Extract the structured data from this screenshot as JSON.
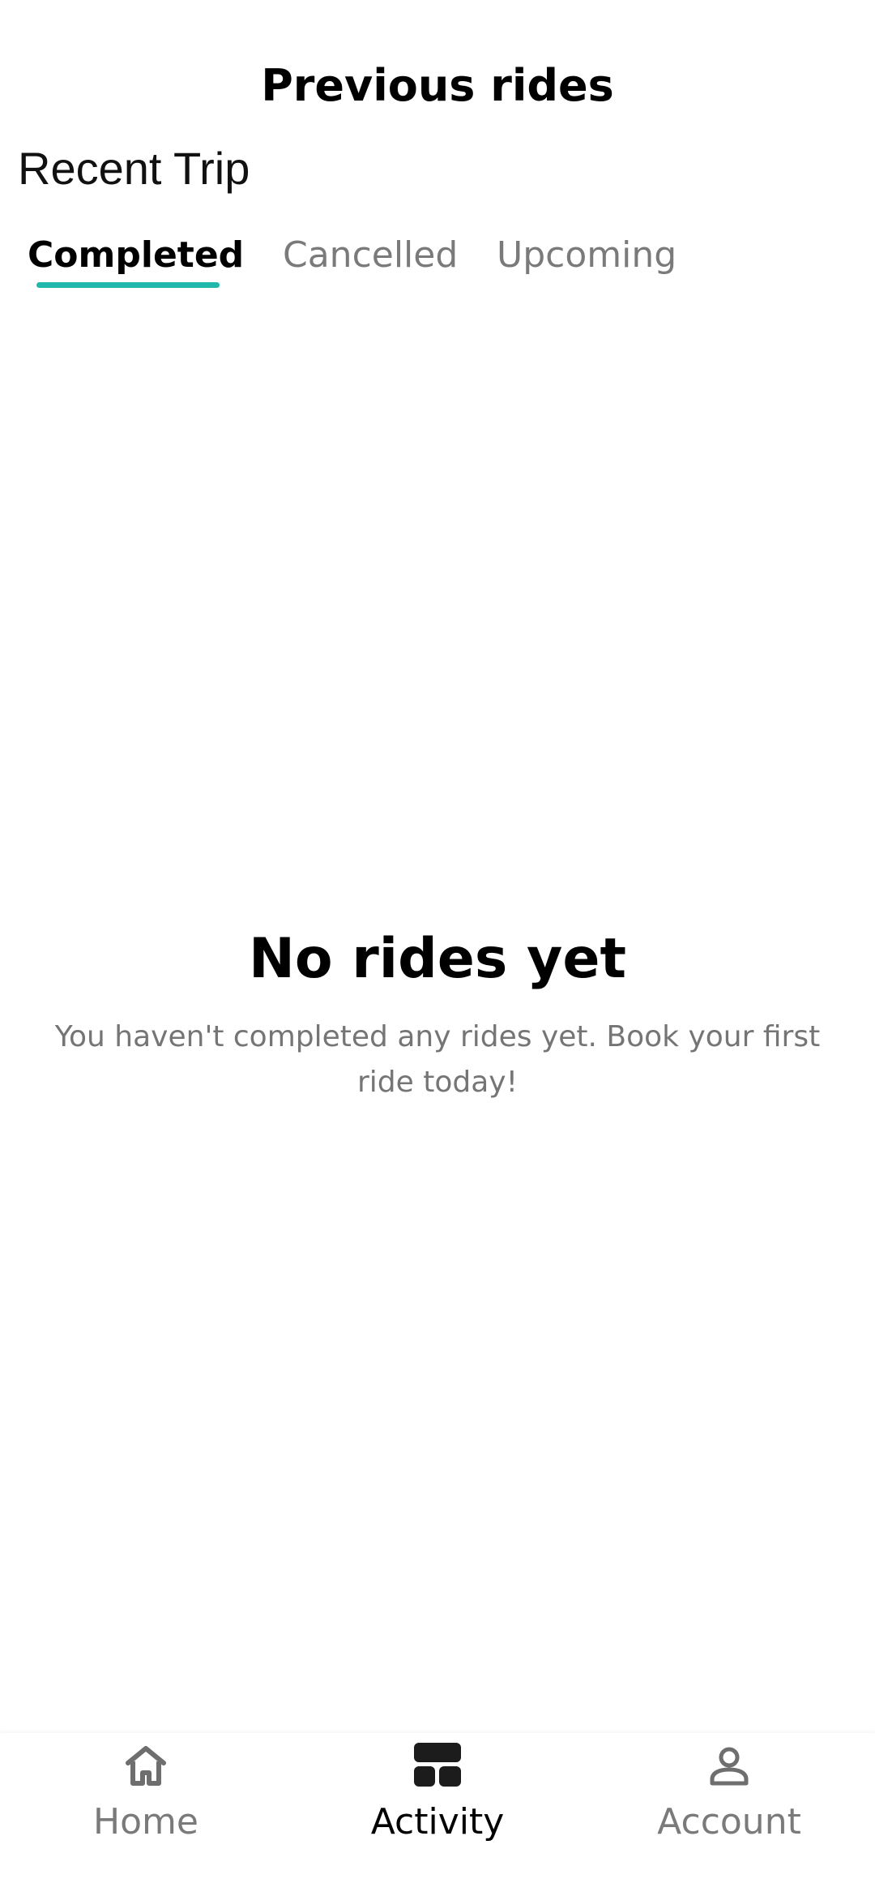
{
  "header": {
    "title": "Previous rides"
  },
  "section": {
    "title": "Recent Trip"
  },
  "tabs": [
    {
      "label": "Completed",
      "active": true
    },
    {
      "label": "Cancelled",
      "active": false
    },
    {
      "label": "Upcoming",
      "active": false
    }
  ],
  "empty_state": {
    "title": "No rides yet",
    "message": "You haven't completed any rides yet. Book your first ride today!"
  },
  "bottom_nav": {
    "items": [
      {
        "label": "Home",
        "icon": "home-icon",
        "active": false
      },
      {
        "label": "Activity",
        "icon": "activity-icon",
        "active": true
      },
      {
        "label": "Account",
        "icon": "account-icon",
        "active": false
      }
    ]
  },
  "colors": {
    "accent": "#1fb8aa",
    "text_primary": "#000000",
    "text_secondary": "#757575"
  }
}
